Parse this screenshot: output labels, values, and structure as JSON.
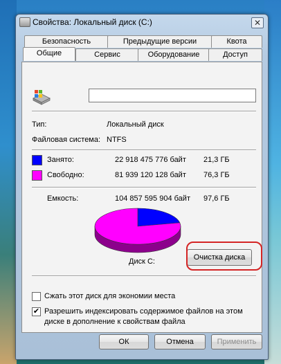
{
  "window": {
    "title": "Свойства: Локальный диск (C:)",
    "close_glyph": "✕"
  },
  "tabs_row1": [
    "Безопасность",
    "Предыдущие версии",
    "Квота"
  ],
  "tabs_row2": [
    "Общие",
    "Сервис",
    "Оборудование",
    "Доступ"
  ],
  "active_tab": "Общие",
  "name_field": {
    "value": ""
  },
  "info": {
    "type_label": "Тип:",
    "type_value": "Локальный диск",
    "fs_label": "Файловая система:",
    "fs_value": "NTFS"
  },
  "usage": {
    "used_label": "Занято:",
    "used_bytes": "22 918 475 776 байт",
    "used_gb": "21,3 ГБ",
    "free_label": "Свободно:",
    "free_bytes": "81 939 120 128 байт",
    "free_gb": "76,3 ГБ",
    "capacity_label": "Емкость:",
    "capacity_bytes": "104 857 595 904 байт",
    "capacity_gb": "97,6 ГБ",
    "used_color": "#0000ff",
    "free_color": "#ff00ff"
  },
  "chart_data": {
    "type": "pie",
    "categories": [
      "Занято",
      "Свободно"
    ],
    "values": [
      21.3,
      76.3
    ],
    "colors": [
      "#0000ff",
      "#ff00ff"
    ]
  },
  "disk_label": "Диск C:",
  "cleanup_button": "Очистка диска",
  "options": {
    "compress_label": "Сжать этот диск для экономии места",
    "compress_checked": false,
    "index_label_line1": "Разрешить индексировать содержимое файлов на этом",
    "index_label_line2": "диске в дополнение к свойствам файла",
    "index_checked": true,
    "check_glyph": "✔"
  },
  "buttons": {
    "ok": "ОК",
    "cancel": "Отмена",
    "apply": "Применить"
  },
  "icons": {
    "window_icon": "drive-icon",
    "drive": "windows-drive-icon"
  }
}
